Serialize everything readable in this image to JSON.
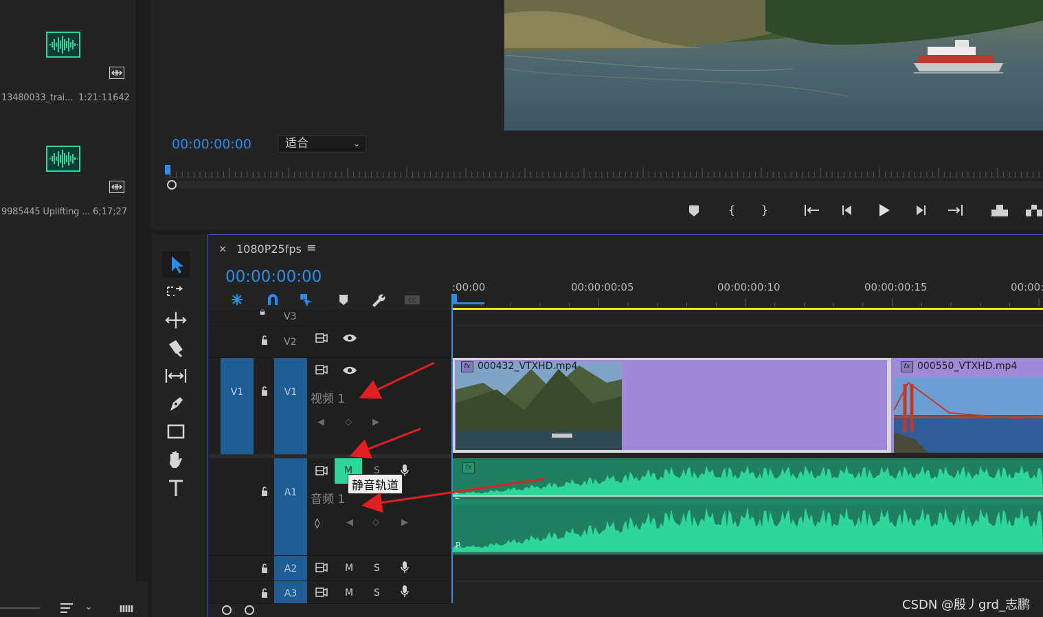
{
  "project_panel": {
    "items": [
      {
        "name": "13480033_trai...",
        "duration": "1:21:11642",
        "thumb_icon": "audio-waveform-icon",
        "badge_icon": "audio-clip-badge-icon"
      },
      {
        "name": "9985445 Uplifting ...",
        "duration": "6;17;27",
        "thumb_icon": "audio-waveform-icon",
        "badge_icon": "audio-clip-badge-icon"
      }
    ],
    "bottom_icons": [
      "sort-icon",
      "chevron-down-icon",
      "list-view-icon"
    ]
  },
  "monitor": {
    "timecode": "00:00:00:00",
    "fit_label": "适合",
    "transport": [
      "marker-icon",
      "mark-in-icon",
      "mark-out-icon",
      "go-to-in-icon",
      "step-back-icon",
      "play-icon",
      "step-forward-icon",
      "go-to-out-icon",
      "lift-icon",
      "extract-icon"
    ]
  },
  "tools": [
    "selection-tool-icon",
    "track-select-tool-icon",
    "ripple-edit-tool-icon",
    "razor-tool-icon",
    "slip-tool-icon",
    "pen-tool-icon",
    "rectangle-tool-icon",
    "hand-tool-icon",
    "type-tool-icon"
  ],
  "timeline": {
    "sequence_name": "1080P25fps",
    "timecode": "00:00:00:00",
    "ruler_labels": [
      ":00:00",
      "00:00:00:05",
      "00:00:00:10",
      "00:00:00:15",
      "00:00:0"
    ],
    "tracks": {
      "v3": {
        "label": "V3"
      },
      "v2": {
        "label": "V2"
      },
      "v1": {
        "source": "V1",
        "label": "V1",
        "name": "视频 1"
      },
      "a1": {
        "label": "A1",
        "name": "音频 1",
        "mute": "M",
        "solo": "S"
      },
      "a2": {
        "label": "A2",
        "mute": "M",
        "solo": "S"
      },
      "a3": {
        "label": "A3",
        "mute": "M",
        "solo": "S"
      }
    },
    "clips": {
      "video1": "000432_VTXHD.mp4",
      "video2": "000550_VTXHD.mp4",
      "audio_fx": "fx",
      "left_channel": "L",
      "right_channel": "R"
    },
    "tooltip": "静音轨道"
  },
  "colors": {
    "accent_blue": "#2d8ceb",
    "audio_green": "#2ed69a",
    "video_purple": "#a08ad8",
    "track_blue": "#1f5d94",
    "work_area_yellow": "#e6e600",
    "arrow_red": "#e02020"
  },
  "watermark": "CSDN @殷丿grd_志鹏"
}
